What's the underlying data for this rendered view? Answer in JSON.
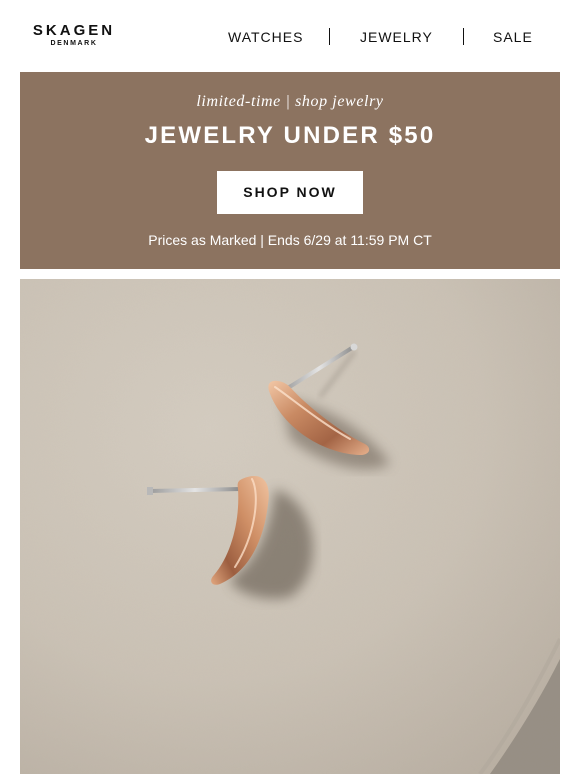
{
  "brand": {
    "name": "SKAGEN",
    "subname": "DENMARK"
  },
  "nav": {
    "items": [
      {
        "label": "WATCHES"
      },
      {
        "label": "JEWELRY"
      },
      {
        "label": "SALE"
      }
    ]
  },
  "promo": {
    "eyebrow": "limited-time | shop jewelry",
    "headline": "JEWELRY UNDER $50",
    "cta_label": "SHOP NOW",
    "terms": "Prices as Marked | Ends 6/29 at 11:59 PM CT"
  },
  "colors": {
    "banner_bg": "#8c7360",
    "button_bg": "#ffffff",
    "earring_gold": "#c98a63",
    "backdrop": "#cbc2b5"
  },
  "hero": {
    "subject": "rose-gold-earrings"
  }
}
